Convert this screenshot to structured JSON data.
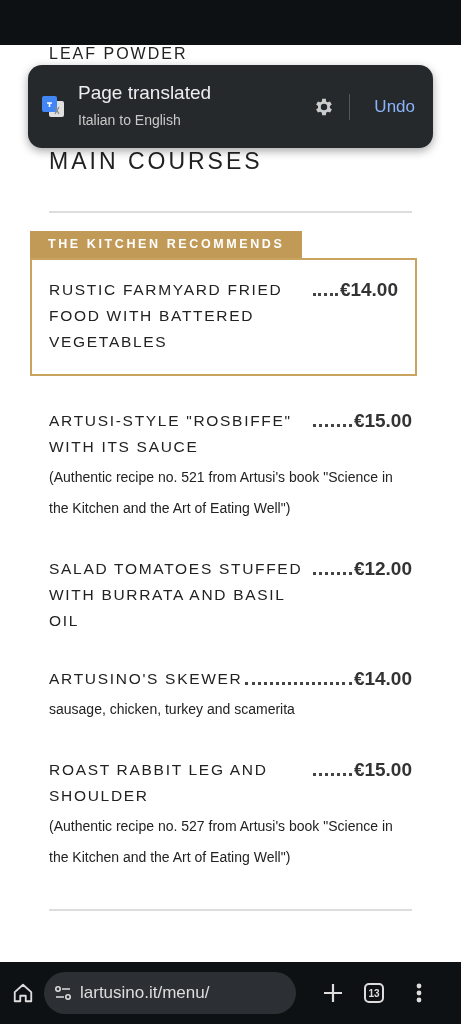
{
  "previous_section_tail": "LEAF POWDER",
  "translate_toast": {
    "title": "Page translated",
    "subtitle": "Italian to English",
    "action": "Undo"
  },
  "section_title": "MAIN COURSES",
  "featured_label": "THE KITCHEN RECOMMENDS",
  "items": [
    {
      "name": "RUSTIC FARMYARD FRIED FOOD WITH BATTERED VEGETABLES",
      "price": "€14.00",
      "featured": true
    },
    {
      "name": "ARTUSI-STYLE \"ROSBIFFE\" WITH ITS SAUCE",
      "price": "€15.00",
      "featured": false,
      "description": "(Authentic recipe no. 521 from Artusi's book \"Science in the Kitchen and the Art of Eating Well\")"
    },
    {
      "name": "SALAD TOMATOES STUFFED WITH BURRATA AND BASIL OIL",
      "price": "€12.00",
      "featured": false
    },
    {
      "name": "ARTUSINO'S SKEWER",
      "price": "€14.00",
      "featured": false,
      "description": "sausage, chicken, turkey and scamerita"
    },
    {
      "name": "ROAST RABBIT LEG AND SHOULDER",
      "price": "€15.00",
      "featured": false,
      "description": "(Authentic recipe no. 527 from Artusi's book \"Science in the Kitchen and the Art of Eating Well\")"
    }
  ],
  "browser_bar": {
    "url": "lartusino.it/menu/",
    "tab_count": "13"
  }
}
